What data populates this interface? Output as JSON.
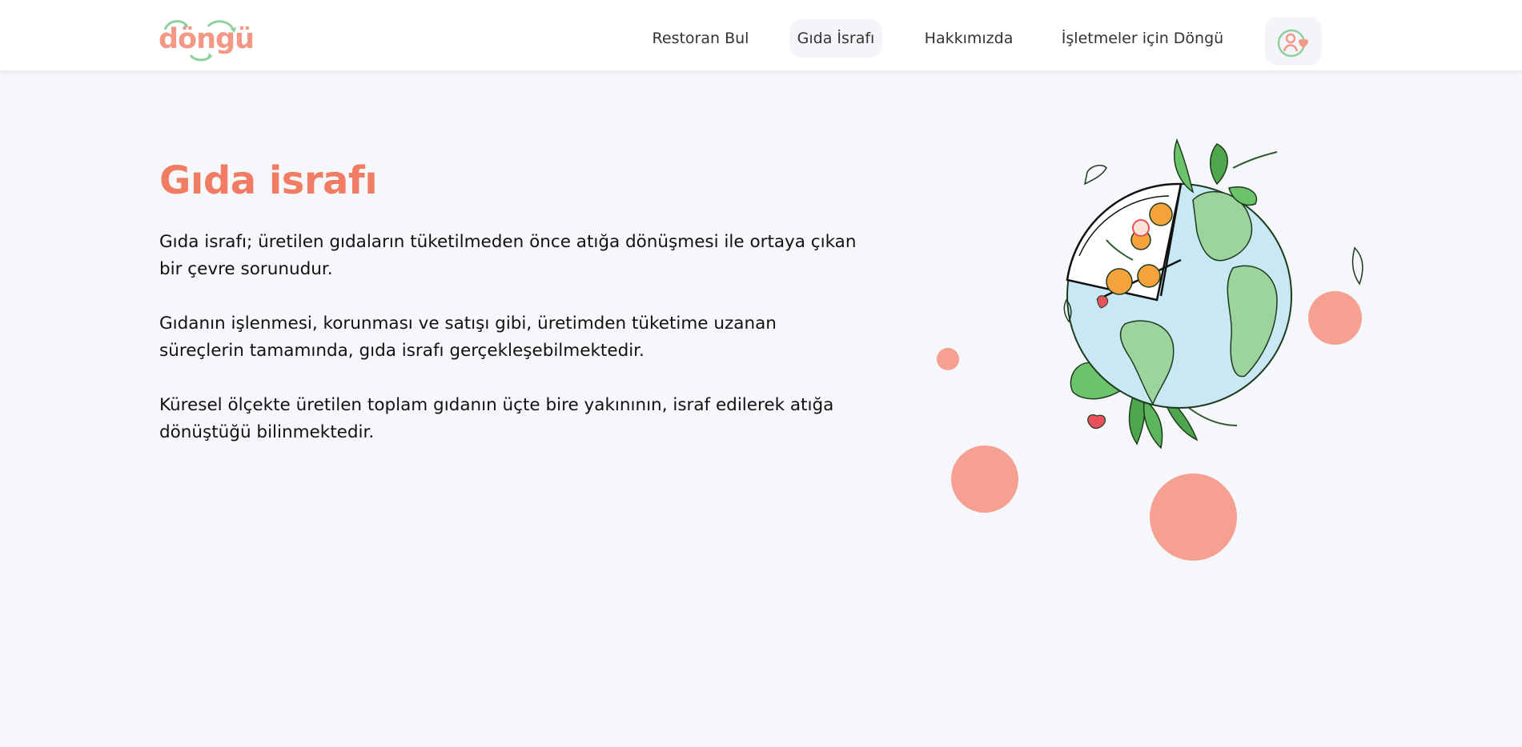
{
  "brand": {
    "logo_text": "döngü"
  },
  "nav": {
    "items": [
      {
        "label": "Restoran Bul"
      },
      {
        "label": "Gıda İsrafı"
      },
      {
        "label": "Hakkımızda"
      },
      {
        "label": "İşletmeler için Döngü"
      }
    ],
    "active_index": 1
  },
  "user_button": {
    "icon": "user-heart-icon"
  },
  "main": {
    "title": "Gıda israfı",
    "paragraphs": [
      "Gıda israfı; üretilen gıdaların tüketilmeden önce atığa dönüşmesi ile ortaya çıkan bir çevre sorunudur.",
      "Gıdanın işlenmesi, korunması ve satışı gibi, üretimden tüketime uzanan süreçlerin tamamında, gıda israfı gerçekleşebilmektedir.",
      "Küresel ölçekte üretilen toplam gıdanın üçte bire yakınının, israf edilerek atığa dönüştüğü bilinmektedir."
    ]
  },
  "colors": {
    "accent": "#f07d63",
    "circle": "#f5a090",
    "leaf_green": "#5bb55a",
    "land_green": "#9dd49e",
    "ocean": "#c8e8f4"
  }
}
